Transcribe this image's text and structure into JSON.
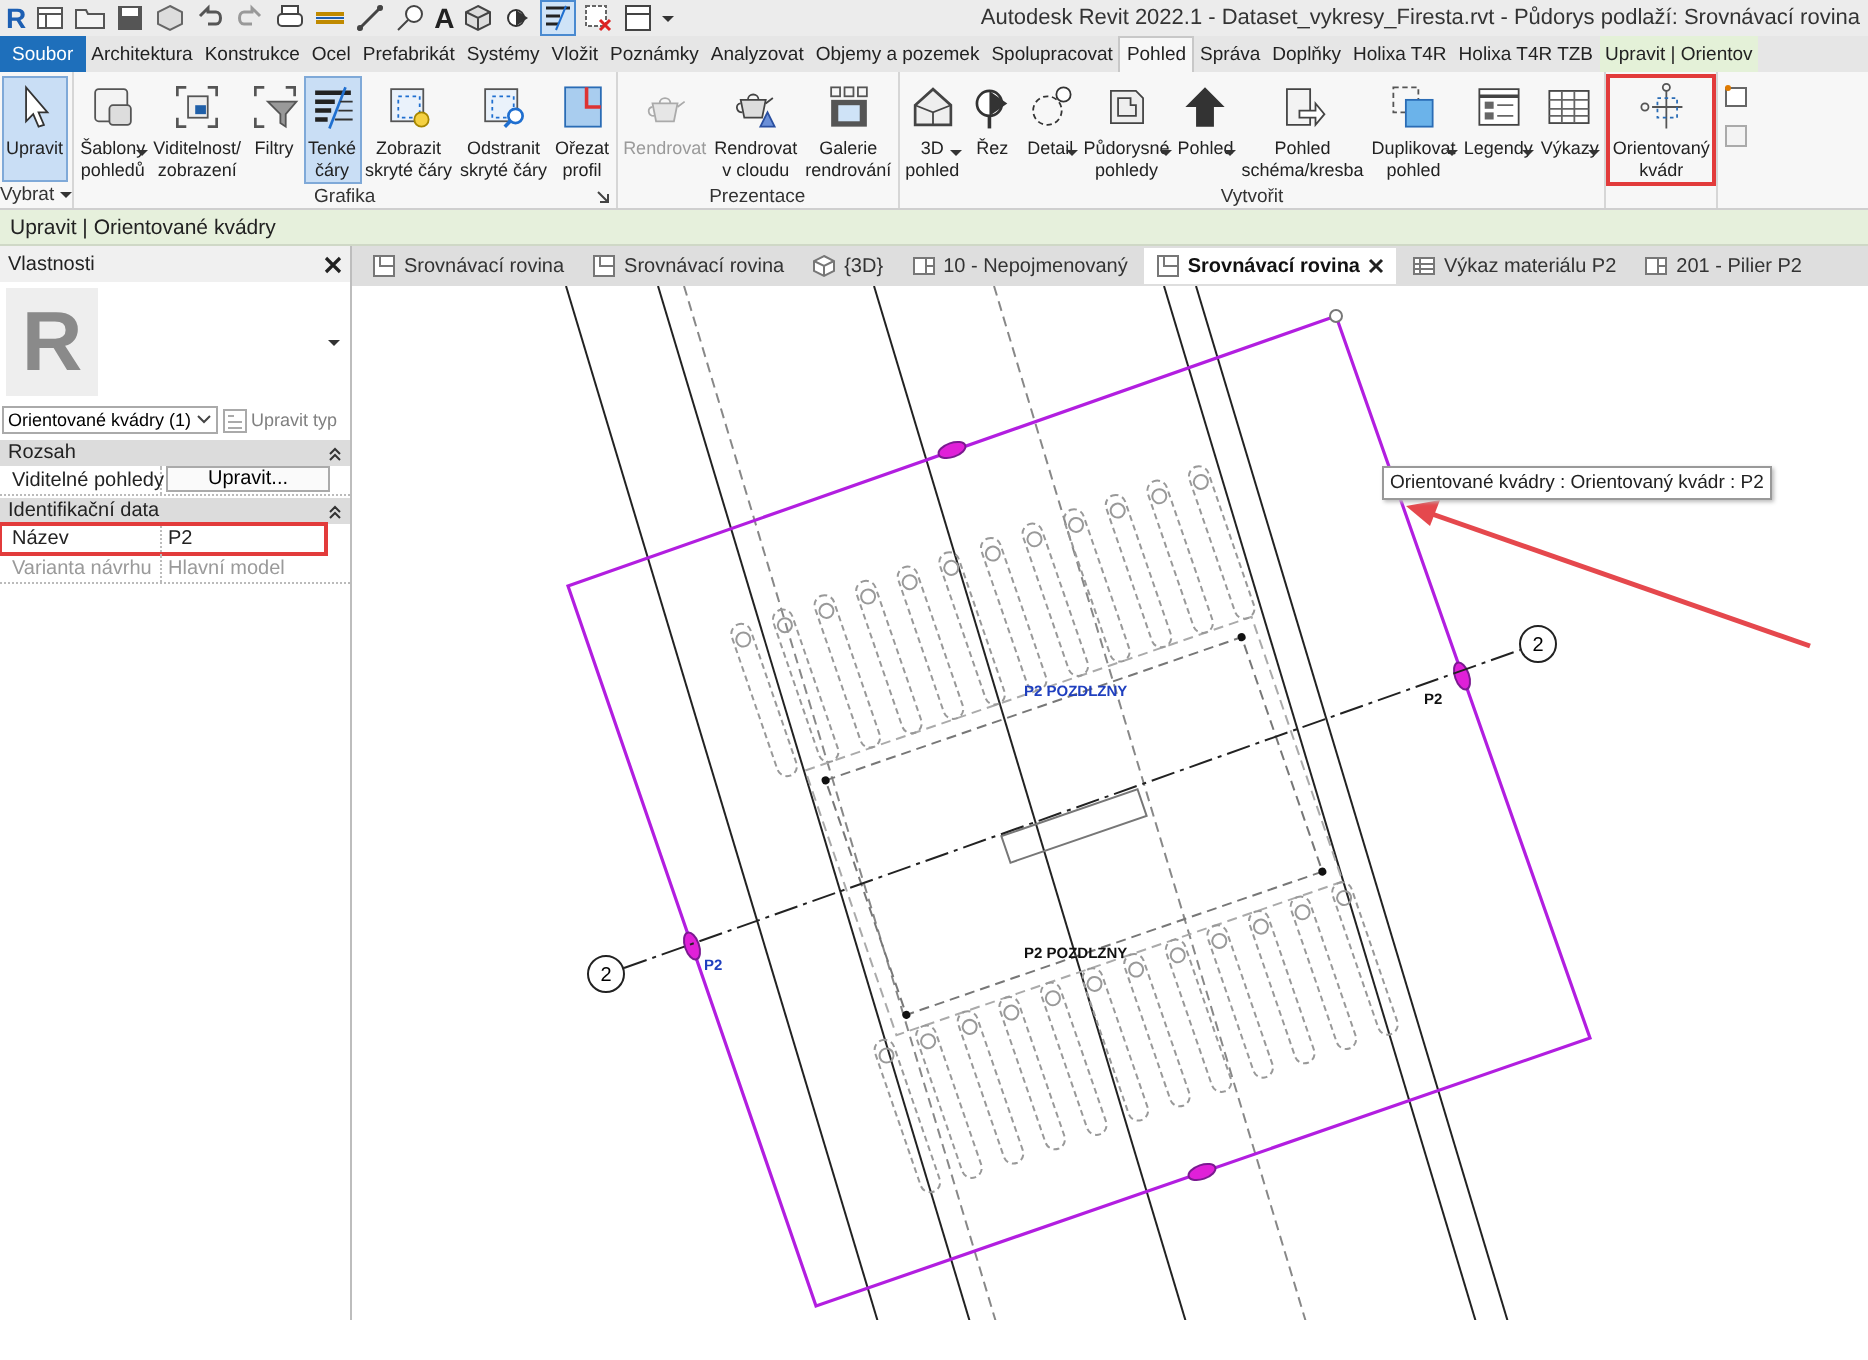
{
  "window": {
    "app_logo": "R",
    "text_tool_glyph": "A",
    "title": "Autodesk Revit 2022.1 - Dataset_vykresy_Firesta.rvt - Půdorys podlaží: Srovnávací rovina"
  },
  "ribbon_tabs": [
    {
      "label": "Soubor",
      "kind": "file",
      "selected": false
    },
    {
      "label": "Architektura",
      "kind": "normal",
      "selected": false
    },
    {
      "label": "Konstrukce",
      "kind": "normal",
      "selected": false
    },
    {
      "label": "Ocel",
      "kind": "normal",
      "selected": false
    },
    {
      "label": "Prefabrikát",
      "kind": "normal",
      "selected": false
    },
    {
      "label": "Systémy",
      "kind": "normal",
      "selected": false
    },
    {
      "label": "Vložit",
      "kind": "normal",
      "selected": false
    },
    {
      "label": "Poznámky",
      "kind": "normal",
      "selected": false
    },
    {
      "label": "Analyzovat",
      "kind": "normal",
      "selected": false
    },
    {
      "label": "Objemy a pozemek",
      "kind": "normal",
      "selected": false
    },
    {
      "label": "Spolupracovat",
      "kind": "normal",
      "selected": false
    },
    {
      "label": "Pohled",
      "kind": "normal",
      "selected": true
    },
    {
      "label": "Správa",
      "kind": "normal",
      "selected": false
    },
    {
      "label": "Doplňky",
      "kind": "normal",
      "selected": false
    },
    {
      "label": "Holixa T4R",
      "kind": "normal",
      "selected": false
    },
    {
      "label": "Holixa T4R TZB",
      "kind": "normal",
      "selected": false
    },
    {
      "label": "Upravit | Orientov",
      "kind": "contextual",
      "selected": false
    }
  ],
  "ribbon": {
    "groups": [
      {
        "label": "Vybrat",
        "dropdown": true,
        "buttons": [
          {
            "lines": [
              "Upravit"
            ],
            "selected": true,
            "disabled": false,
            "dropdown": false,
            "highlighted": false
          }
        ]
      },
      {
        "label": "Grafika",
        "launcher": true,
        "buttons": [
          {
            "lines": [
              "Šablony",
              "pohledů"
            ],
            "selected": false,
            "disabled": false,
            "dropdown": true,
            "highlighted": false
          },
          {
            "lines": [
              "Viditelnost/",
              "zobrazení"
            ],
            "selected": false,
            "disabled": false,
            "dropdown": false,
            "highlighted": false
          },
          {
            "lines": [
              "Filtry"
            ],
            "selected": false,
            "disabled": false,
            "dropdown": false,
            "highlighted": false
          },
          {
            "lines": [
              "Tenké",
              "čáry"
            ],
            "selected": true,
            "disabled": false,
            "dropdown": false,
            "highlighted": false
          },
          {
            "lines": [
              "Zobrazit",
              "skryté čáry"
            ],
            "selected": false,
            "disabled": false,
            "dropdown": false,
            "highlighted": false
          },
          {
            "lines": [
              "Odstranit",
              "skryté čáry"
            ],
            "selected": false,
            "disabled": false,
            "dropdown": false,
            "highlighted": false
          },
          {
            "lines": [
              "Ořezat",
              "profil"
            ],
            "selected": false,
            "disabled": false,
            "dropdown": false,
            "highlighted": false
          }
        ]
      },
      {
        "label": "Prezentace",
        "buttons": [
          {
            "lines": [
              "Rendrovat"
            ],
            "selected": false,
            "disabled": true,
            "dropdown": false,
            "highlighted": false
          },
          {
            "lines": [
              "Rendrovat",
              "v cloudu"
            ],
            "selected": false,
            "disabled": false,
            "dropdown": false,
            "highlighted": false
          },
          {
            "lines": [
              "Galerie",
              "rendrování"
            ],
            "selected": false,
            "disabled": false,
            "dropdown": false,
            "highlighted": false
          }
        ]
      },
      {
        "label": "Vytvořit",
        "buttons": [
          {
            "lines": [
              "3D",
              "pohled"
            ],
            "selected": false,
            "disabled": false,
            "dropdown": true,
            "highlighted": false
          },
          {
            "lines": [
              "Řez"
            ],
            "selected": false,
            "disabled": false,
            "dropdown": false,
            "highlighted": false
          },
          {
            "lines": [
              "Detail"
            ],
            "selected": false,
            "disabled": false,
            "dropdown": true,
            "highlighted": false
          },
          {
            "lines": [
              "Půdorysné",
              "pohledy"
            ],
            "selected": false,
            "disabled": false,
            "dropdown": true,
            "highlighted": false
          },
          {
            "lines": [
              "Pohled"
            ],
            "selected": false,
            "disabled": false,
            "dropdown": true,
            "highlighted": false
          },
          {
            "lines": [
              "Pohled",
              "schéma/kresba"
            ],
            "selected": false,
            "disabled": false,
            "dropdown": false,
            "highlighted": false
          },
          {
            "lines": [
              "Duplikovat",
              "pohled"
            ],
            "selected": false,
            "disabled": false,
            "dropdown": true,
            "highlighted": false
          },
          {
            "lines": [
              "Legendy"
            ],
            "selected": false,
            "disabled": false,
            "dropdown": true,
            "highlighted": false
          },
          {
            "lines": [
              "Výkazy"
            ],
            "selected": false,
            "disabled": false,
            "dropdown": true,
            "highlighted": false
          }
        ]
      },
      {
        "buttons": [
          {
            "lines": [
              "Orientovaný",
              "kvádr"
            ],
            "selected": false,
            "disabled": false,
            "dropdown": false,
            "highlighted": true
          }
        ]
      }
    ]
  },
  "context_bar": "Upravit | Orientované kvádry",
  "properties": {
    "title": "Vlastnosti",
    "preview_letter": "R",
    "type_selector": "Orientované kvádry (1)",
    "edit_type_button": {
      "label": "Upravit typ",
      "disabled": true
    },
    "sections": [
      {
        "title": "Rozsah",
        "rows": [
          {
            "name": "Viditelné pohledy",
            "value": "Upravit...",
            "kind": "button",
            "disabled": false,
            "highlighted": false
          }
        ]
      },
      {
        "title": "Identifikační data",
        "rows": [
          {
            "name": "Název",
            "value": "P2",
            "kind": "text",
            "disabled": false,
            "highlighted": true
          },
          {
            "name": "Varianta návrhu",
            "value": "Hlavní model",
            "kind": "text",
            "disabled": true,
            "highlighted": false
          }
        ]
      }
    ]
  },
  "view_tabs": [
    {
      "label": "Srovnávací rovina",
      "kind": "plan",
      "selected": false
    },
    {
      "label": "Srovnávací rovina",
      "kind": "plan",
      "selected": false
    },
    {
      "label": "{3D}",
      "kind": "model",
      "selected": false
    },
    {
      "label": "10 - Nepojmenovaný",
      "kind": "sheet",
      "selected": false
    },
    {
      "label": "Srovnávací rovina",
      "kind": "plan",
      "selected": true
    },
    {
      "label": "Výkaz materiálu P2",
      "kind": "schedule",
      "selected": false
    },
    {
      "label": "201 - Pilier P2",
      "kind": "sheet",
      "selected": false
    }
  ],
  "canvas": {
    "grid_bubbles": [
      "2",
      "2"
    ],
    "labels": [
      {
        "text": "P2 POZDLZNY",
        "selected": true
      },
      {
        "text": "P2 POZDLZNY",
        "selected": false
      },
      {
        "text": "P2",
        "selected": true
      },
      {
        "text": "P2",
        "selected": false
      }
    ],
    "tooltip": "Orientované kvádry : Orientovaný kvádr : P2"
  }
}
